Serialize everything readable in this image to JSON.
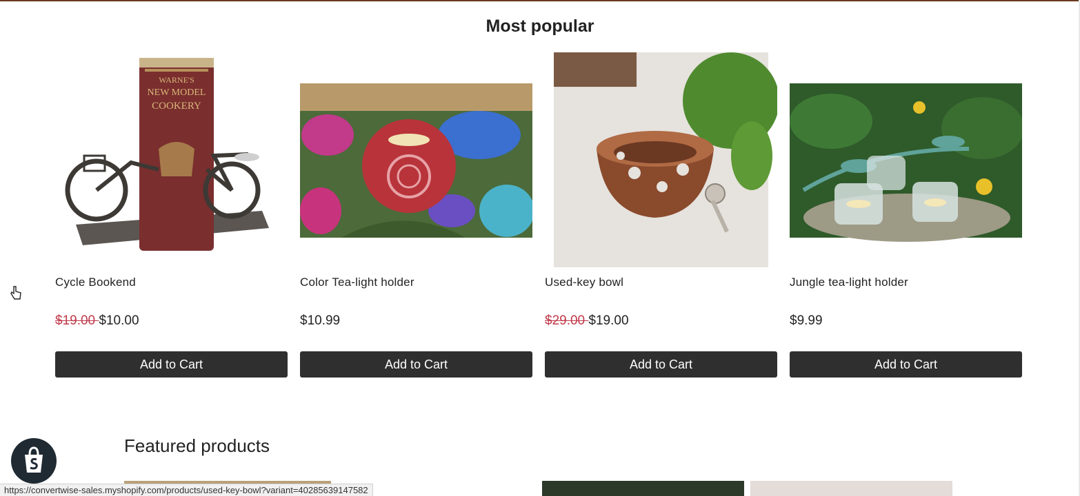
{
  "section": {
    "title": "Most popular"
  },
  "products": [
    {
      "name": "Cycle Bookend",
      "price_old": "$19.00 ",
      "price": "$10.00",
      "button": "Add to Cart",
      "icon": "cycle-bookend-image"
    },
    {
      "name": "Color Tea-light holder",
      "price_old": "",
      "price": "$10.99",
      "button": "Add to Cart",
      "icon": "tea-light-holder-image"
    },
    {
      "name": "Used-key bowl",
      "price_old": "$29.00 ",
      "price": "$19.00",
      "button": "Add to Cart",
      "icon": "used-key-bowl-image"
    },
    {
      "name": "Jungle tea-light holder",
      "price_old": "",
      "price": "$9.99",
      "button": "Add to Cart",
      "icon": "jungle-tea-light-image"
    }
  ],
  "featured": {
    "title": "Featured products"
  },
  "status_bar": {
    "url": "https://convertwise-sales.myshopify.com/products/used-key-bowl?variant=40285639147582"
  },
  "colors": {
    "button_bg": "#2f2f2f",
    "sale_price": "#c0394a",
    "text": "#222222"
  }
}
